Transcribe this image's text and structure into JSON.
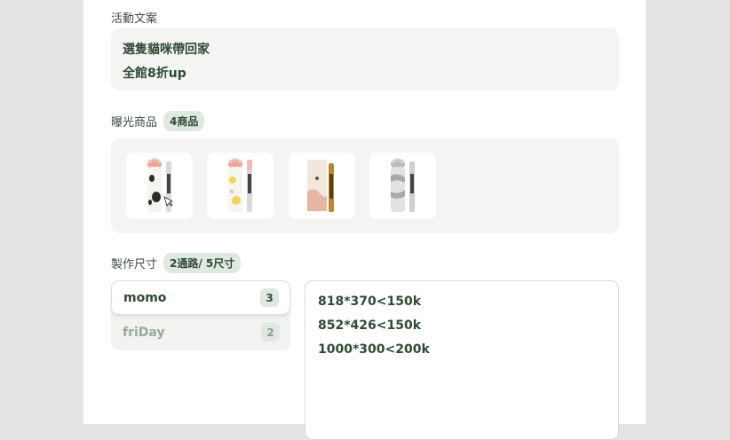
{
  "campaign_copy": {
    "label": "活動文案",
    "lines": [
      "選隻貓咪帶回家",
      "全館8折up"
    ]
  },
  "products": {
    "label": "曝光商品",
    "count_chip": "4商品",
    "items": [
      {
        "name": "product-thumb-1",
        "palette": "cow"
      },
      {
        "name": "product-thumb-2",
        "palette": "yellow-pink"
      },
      {
        "name": "product-thumb-3",
        "palette": "gold-box"
      },
      {
        "name": "product-thumb-4",
        "palette": "grey-camo"
      }
    ]
  },
  "sizes": {
    "label": "製作尺寸",
    "chip": "2通路/ 5尺寸",
    "channels": [
      {
        "label": "momo",
        "count": "3",
        "active": true
      },
      {
        "label": "friDay",
        "count": "2",
        "active": false
      }
    ],
    "list": [
      "818*370<150k",
      "852*426<150k",
      "1000*300<200k"
    ]
  }
}
